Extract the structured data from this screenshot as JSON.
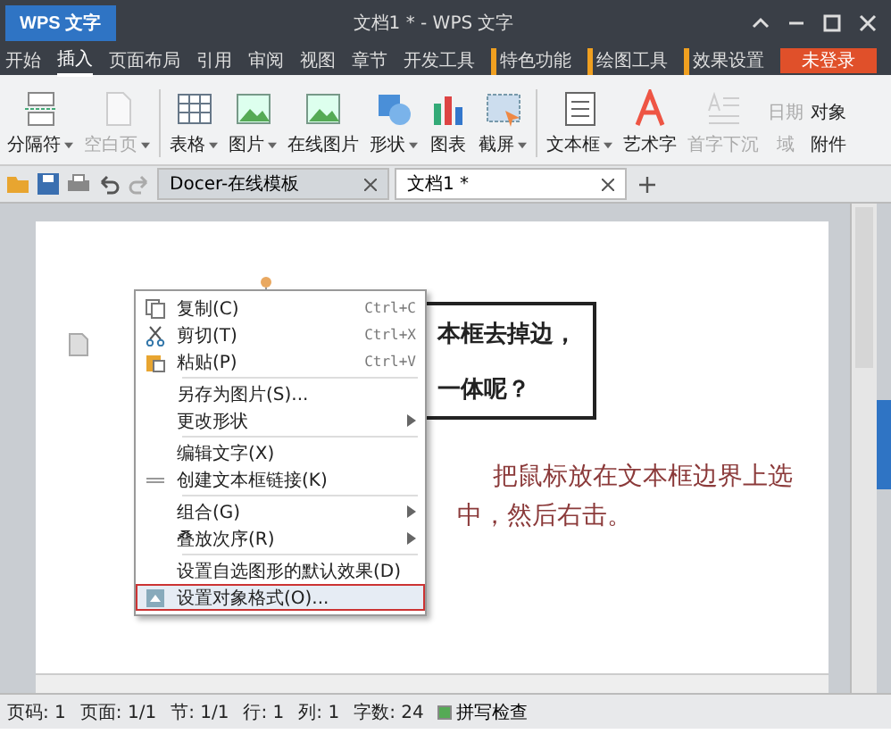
{
  "window": {
    "app_button": "WPS 文字",
    "title": "文档1 * - WPS 文字"
  },
  "menu_tabs": [
    {
      "label": "开始",
      "selected": false,
      "kind": "plain"
    },
    {
      "label": "插入",
      "selected": true,
      "kind": "plain"
    },
    {
      "label": "页面布局",
      "selected": false,
      "kind": "plain"
    },
    {
      "label": "引用",
      "selected": false,
      "kind": "plain"
    },
    {
      "label": "审阅",
      "selected": false,
      "kind": "plain"
    },
    {
      "label": "视图",
      "selected": false,
      "kind": "plain"
    },
    {
      "label": "章节",
      "selected": false,
      "kind": "plain"
    },
    {
      "label": "开发工具",
      "selected": false,
      "kind": "plain"
    },
    {
      "label": "特色功能",
      "selected": false,
      "kind": "marked"
    },
    {
      "label": "绘图工具",
      "selected": false,
      "kind": "marked"
    },
    {
      "label": "效果设置",
      "selected": false,
      "kind": "marked"
    },
    {
      "label": "未登录",
      "selected": false,
      "kind": "account"
    }
  ],
  "ribbon": [
    {
      "label": "分隔符",
      "dropdown": true,
      "disabled": false
    },
    {
      "label": "空白页",
      "dropdown": true,
      "disabled": true
    },
    {
      "label": "表格",
      "dropdown": true,
      "disabled": false
    },
    {
      "label": "图片",
      "dropdown": true,
      "disabled": false
    },
    {
      "label": "在线图片",
      "dropdown": false,
      "disabled": false
    },
    {
      "label": "形状",
      "dropdown": true,
      "disabled": false
    },
    {
      "label": "图表",
      "dropdown": false,
      "disabled": false
    },
    {
      "label": "截屏",
      "dropdown": true,
      "disabled": false
    },
    {
      "label": "文本框",
      "dropdown": true,
      "disabled": false
    },
    {
      "label": "艺术字",
      "dropdown": false,
      "disabled": false
    },
    {
      "label": "首字下沉",
      "dropdown": false,
      "disabled": true
    }
  ],
  "ribbon_small": [
    {
      "label": "日期",
      "disabled": true
    },
    {
      "label": "域",
      "disabled": true
    },
    {
      "label": "对象",
      "disabled": false
    },
    {
      "label": "附件",
      "disabled": false
    }
  ],
  "doc_tabs": [
    {
      "label": "Docer-在线模板",
      "selected": false
    },
    {
      "label": "文档1 *",
      "selected": true
    }
  ],
  "document": {
    "textbox_lines": [
      "本框去掉边，",
      "一体呢？"
    ],
    "note_lines": [
      "把鼠标放在文本框边界上选",
      "中，然后右击。"
    ]
  },
  "context_menu": [
    {
      "kind": "item",
      "label": "复制(C)",
      "shortcut": "Ctrl+C",
      "submenu": false,
      "selected": false
    },
    {
      "kind": "item",
      "label": "剪切(T)",
      "shortcut": "Ctrl+X",
      "submenu": false,
      "selected": false
    },
    {
      "kind": "item",
      "label": "粘贴(P)",
      "shortcut": "Ctrl+V",
      "submenu": false,
      "selected": false
    },
    {
      "kind": "separator"
    },
    {
      "kind": "item",
      "label": "另存为图片(S)...",
      "submenu": false,
      "selected": false
    },
    {
      "kind": "item",
      "label": "更改形状",
      "submenu": true,
      "selected": false
    },
    {
      "kind": "separator"
    },
    {
      "kind": "item",
      "label": "编辑文字(X)",
      "submenu": false,
      "selected": false
    },
    {
      "kind": "item",
      "label": "创建文本框链接(K)",
      "submenu": false,
      "selected": false
    },
    {
      "kind": "separator"
    },
    {
      "kind": "item",
      "label": "组合(G)",
      "submenu": true,
      "selected": false
    },
    {
      "kind": "item",
      "label": "叠放次序(R)",
      "submenu": true,
      "selected": false
    },
    {
      "kind": "separator"
    },
    {
      "kind": "item",
      "label": "设置自选图形的默认效果(D)",
      "submenu": false,
      "selected": false
    },
    {
      "kind": "item",
      "label": "设置对象格式(O)...",
      "submenu": false,
      "selected": true
    }
  ],
  "status_bar": [
    {
      "label": "页码: 1"
    },
    {
      "label": "页面: 1/1"
    },
    {
      "label": "节: 1/1"
    },
    {
      "label": "行: 1"
    },
    {
      "label": "列: 1"
    },
    {
      "label": "字数: 24"
    }
  ],
  "spell_check": {
    "label": "拼写检查",
    "on": true
  }
}
